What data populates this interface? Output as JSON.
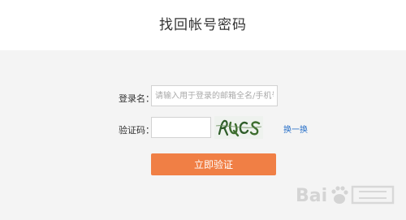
{
  "page": {
    "title": "找回帐号密码"
  },
  "form": {
    "username_label": "登录名：",
    "username_placeholder": "请输入用于登录的邮箱全名/手机号",
    "captcha_label": "验证码：",
    "captcha_refresh": "换一换",
    "submit": "立即验证"
  },
  "colors": {
    "accent": "#f07f45",
    "link": "#2b72c9",
    "form_background": "#f4f4f4"
  },
  "icons": {
    "captcha": "captcha-image",
    "watermark": "baidu-jingyan-watermark"
  }
}
